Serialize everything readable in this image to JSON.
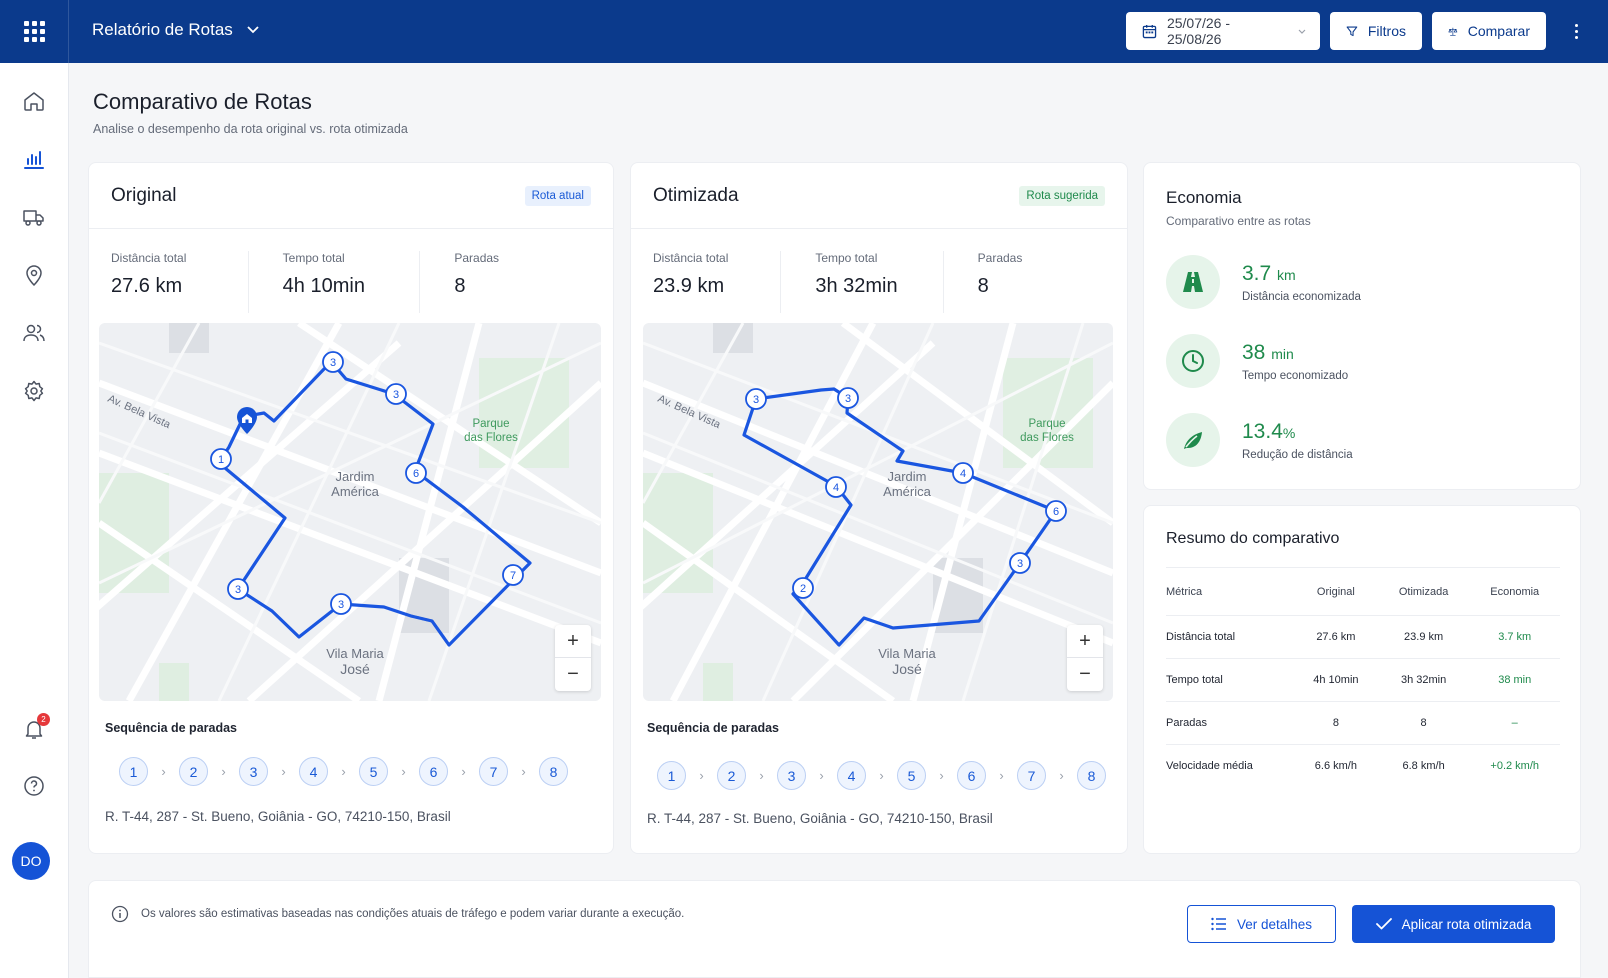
{
  "topbar": {
    "app_title": "Relatório de Rotas",
    "date_range": "25/07/26 - 25/08/26",
    "filters_label": "Filtros",
    "compare_label": "Comparar"
  },
  "sidebar": {
    "items": [
      "home-icon",
      "chart-icon",
      "truck-icon",
      "location-icon",
      "users-icon",
      "settings-icon"
    ],
    "notifications_count": "2",
    "avatar_initials": "DO"
  },
  "header": {
    "title": "Comparativo de Rotas",
    "subtitle": "Analise o desempenho da rota original vs. rota otimizada"
  },
  "original": {
    "title": "Original",
    "tag": "Rota atual",
    "stats": [
      {
        "label": "Distância total",
        "value": "27.6 km"
      },
      {
        "label": "Tempo total",
        "value": "4h 10min"
      },
      {
        "label": "Paradas",
        "value": "8"
      }
    ],
    "map_labels": {
      "street": "Av. Bela Vista",
      "park_1": "Parque",
      "park_2": "das Flores",
      "district_1": "Jardim",
      "district_2": "América",
      "district_3": "Vila Maria",
      "district_4": "José"
    },
    "markers": [
      "3",
      "3",
      "6",
      "1",
      "3",
      "3",
      "7"
    ],
    "sequence_title": "Sequência de paradas",
    "sequence": [
      "1",
      "2",
      "3",
      "4",
      "5",
      "6",
      "7",
      "8"
    ],
    "address": "R. T-44, 287 - St. Bueno, Goiânia - GO, 74210-150, Brasil"
  },
  "optimized": {
    "title": "Otimizada",
    "tag": "Rota sugerida",
    "stats": [
      {
        "label": "Distância total",
        "value": "23.9 km"
      },
      {
        "label": "Tempo total",
        "value": "3h 32min"
      },
      {
        "label": "Paradas",
        "value": "8"
      }
    ],
    "map_labels": {
      "street": "Av. Bela Vista",
      "park_1": "Parque",
      "park_2": "das Flores",
      "district_1": "Jardim",
      "district_2": "América",
      "district_3": "Vila Maria",
      "district_4": "José"
    },
    "markers": [
      "3",
      "3",
      "4",
      "4",
      "6",
      "3",
      "2"
    ],
    "sequence_title": "Sequência de paradas",
    "sequence": [
      "1",
      "2",
      "3",
      "4",
      "5",
      "6",
      "7",
      "8"
    ],
    "address": "R. T-44, 287 - St. Bueno, Goiânia - GO, 74210-150, Brasil"
  },
  "economy": {
    "title": "Economia",
    "subtitle": "Comparativo entre as rotas",
    "items": [
      {
        "value": "3.7",
        "unit": "km",
        "label": "Distância economizada",
        "icon": "road-icon"
      },
      {
        "value": "38",
        "unit": "min",
        "label": "Tempo economizado",
        "icon": "clock-icon"
      },
      {
        "value": "13.4",
        "unit": "%",
        "label": "Redução de distância",
        "icon": "leaf-icon"
      }
    ]
  },
  "summary": {
    "title": "Resumo do comparativo",
    "headers": [
      "Métrica",
      "Original",
      "Otimizada",
      "Economia"
    ],
    "rows": [
      [
        "Distância total",
        "27.6 km",
        "23.9 km",
        "3.7 km"
      ],
      [
        "Tempo total",
        "4h 10min",
        "3h 32min",
        "38 min"
      ],
      [
        "Paradas",
        "8",
        "8",
        "–"
      ],
      [
        "Velocidade média",
        "6.6 km/h",
        "6.8 km/h",
        "+0.2 km/h"
      ]
    ]
  },
  "footer": {
    "info": "Os valores são estimativas baseadas nas condições atuais de tráfego e podem variar durante a execução.",
    "details_label": "Ver detalhes",
    "apply_label": "Aplicar rota otimizada"
  },
  "colors": {
    "brand": "#0b3a8c",
    "primary": "#1553d6",
    "route": "#1a56e0",
    "success": "#1f8a4c"
  }
}
